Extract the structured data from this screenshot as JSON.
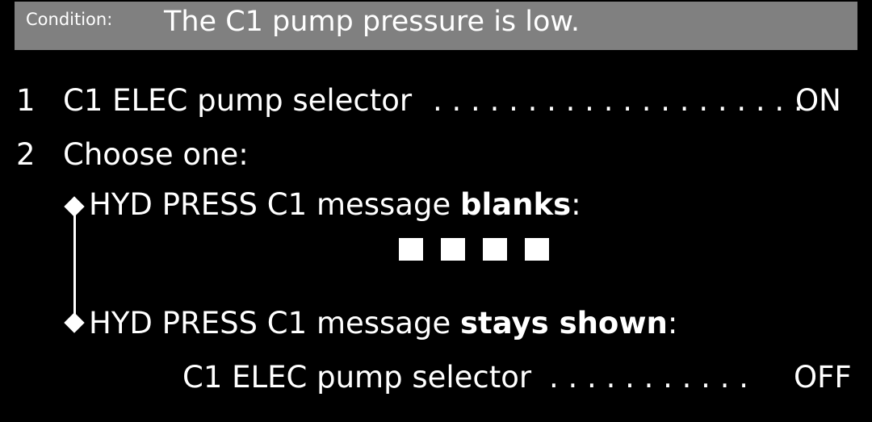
{
  "condition": {
    "label": "Condition:",
    "text": "The C1 pump pressure is low."
  },
  "steps": [
    {
      "number": "1",
      "text": "C1 ELEC pump selector",
      "dots": ". . . . . . . . . . . . . . . . . . . .",
      "action": "ON"
    },
    {
      "number": "2",
      "text": "Choose one:"
    }
  ],
  "options": [
    {
      "prefix": "HYD PRESS C1 message ",
      "emphasis": "blanks",
      "suffix": ":"
    },
    {
      "prefix": "HYD PRESS C1 message ",
      "emphasis": "stays shown",
      "suffix": ":"
    }
  ],
  "substep": {
    "text": "C1 ELEC pump selector",
    "dots": ". . . . . . . . . . .",
    "action": "OFF"
  },
  "colors": {
    "background": "#000000",
    "condition_bar": "#808080",
    "text": "#ffffff"
  }
}
